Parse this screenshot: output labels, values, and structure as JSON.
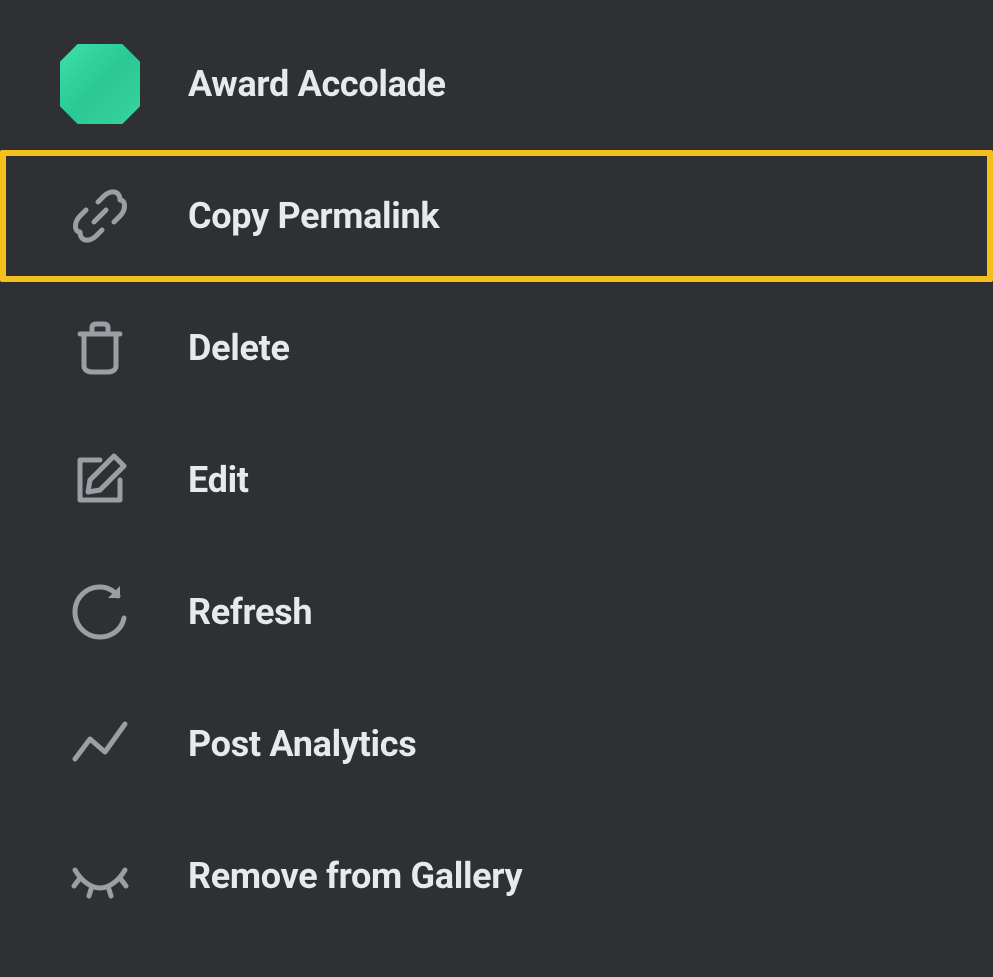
{
  "menu": {
    "items": [
      {
        "label": "Award Accolade",
        "icon": "gem-icon",
        "highlighted": false
      },
      {
        "label": "Copy Permalink",
        "icon": "link-icon",
        "highlighted": true
      },
      {
        "label": "Delete",
        "icon": "trash-icon",
        "highlighted": false
      },
      {
        "label": "Edit",
        "icon": "edit-icon",
        "highlighted": false
      },
      {
        "label": "Refresh",
        "icon": "refresh-icon",
        "highlighted": false
      },
      {
        "label": "Post Analytics",
        "icon": "analytics-icon",
        "highlighted": false
      },
      {
        "label": "Remove from Gallery",
        "icon": "eye-closed-icon",
        "highlighted": false
      }
    ]
  },
  "colors": {
    "background": "#2e3034",
    "text": "#e8e9ea",
    "iconStroke": "#9b9ea3",
    "highlight": "#f5c01e",
    "gemGradientStart": "#3de0a8",
    "gemGradientEnd": "#2bc894"
  }
}
